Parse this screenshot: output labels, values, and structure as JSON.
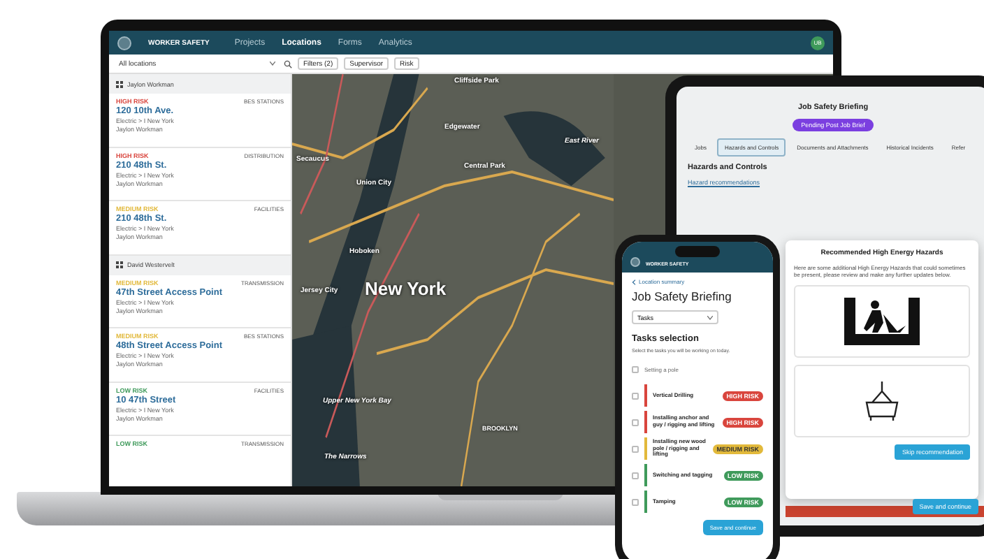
{
  "laptop": {
    "app_name": "WORKER SAFETY",
    "nav": [
      {
        "label": "Projects",
        "selected": false
      },
      {
        "label": "Locations",
        "selected": true
      },
      {
        "label": "Forms",
        "selected": false
      },
      {
        "label": "Analytics",
        "selected": false
      }
    ],
    "avatar": "UB",
    "toolbar": {
      "location_select": "All locations",
      "filters": "Filters (2)",
      "supervisor": "Supervisor",
      "risk": "Risk"
    },
    "groups": [
      {
        "name": "Jaylon Workman",
        "items": [
          {
            "color": "#d9453d",
            "risk_label": "HIGH RISK",
            "category": "BES STATIONS",
            "title": "120 10th Ave.",
            "path": "Electric > I New York",
            "person": "Jaylon Workman"
          },
          {
            "color": "#d9453d",
            "risk_label": "HIGH RISK",
            "category": "DISTRIBUTION",
            "title": "210 48th St.",
            "path": "Electric > I New York",
            "person": "Jaylon Workman"
          },
          {
            "color": "#e2b93b",
            "risk_label": "MEDIUM RISK",
            "category": "FACILITIES",
            "title": "210 48th St.",
            "path": "Electric > I New York",
            "person": "Jaylon Workman"
          }
        ]
      },
      {
        "name": "David Westervelt",
        "items": [
          {
            "color": "#e2b93b",
            "risk_label": "MEDIUM RISK",
            "category": "TRANSMISSION",
            "title": "47th Street Access Point",
            "path": "Electric > I New York",
            "person": "Jaylon Workman"
          },
          {
            "color": "#e2b93b",
            "risk_label": "MEDIUM RISK",
            "category": "BES STATIONS",
            "title": "48th Street Access Point",
            "path": "Electric > I New York",
            "person": "Jaylon Workman"
          },
          {
            "color": "#3f9a5b",
            "risk_label": "LOW RISK",
            "category": "FACILITIES",
            "title": "10 47th Street",
            "path": "Electric > I New York",
            "person": "Jaylon Workman"
          },
          {
            "color": "#3f9a5b",
            "risk_label": "LOW RISK",
            "category": "TRANSMISSION"
          }
        ]
      }
    ],
    "map_labels": [
      {
        "text": "Cliffside Park",
        "kind": "place"
      },
      {
        "text": "Edgewater",
        "kind": "place"
      },
      {
        "text": "Secaucus",
        "kind": "place"
      },
      {
        "text": "Union City",
        "kind": "place"
      },
      {
        "text": "Hoboken",
        "kind": "place"
      },
      {
        "text": "Jersey City",
        "kind": "place"
      },
      {
        "text": "New York",
        "kind": "city"
      },
      {
        "text": "Central Park",
        "kind": "place"
      },
      {
        "text": "East River",
        "kind": "water"
      },
      {
        "text": "Upper New York Bay",
        "kind": "water"
      },
      {
        "text": "The Narrows",
        "kind": "water"
      },
      {
        "text": "BROOKLYN",
        "kind": "district"
      }
    ]
  },
  "tablet": {
    "title": "Job Safety Briefing",
    "status": "Pending Post Job Brief",
    "tabs": [
      {
        "label": "Jobs",
        "selected": false
      },
      {
        "label": "Hazards and Controls",
        "selected": true
      },
      {
        "label": "Documents and Attachments",
        "selected": false
      },
      {
        "label": "Historical Incidents",
        "selected": false
      },
      {
        "label": "Refer",
        "selected": false
      }
    ],
    "section_title": "Hazards and Controls",
    "link": "Hazard recommendations",
    "modal": {
      "title": "Recommended High Energy Hazards",
      "body": "Here are some additional High Energy Hazards that could sometimes be present, please review and make any further updates below.",
      "skip_button": "Skip recommendation"
    },
    "save_button": "Save and continue"
  },
  "phone": {
    "app_name": "WORKER SAFETY",
    "back_link": "Location summary",
    "title": "Job Safety Briefing",
    "select": "Tasks",
    "section_title": "Tasks selection",
    "section_hint": "Select the tasks you will be working on today.",
    "group": "Setting a pole",
    "group_checked": false,
    "tasks": [
      {
        "name": "Vertical Drilling",
        "color": "#d9453d",
        "risk_label": "HIGH RISK",
        "checked": false
      },
      {
        "name": "Installing anchor and guy / rigging and lifting",
        "color": "#d9453d",
        "risk_label": "HIGH RISK",
        "checked": false
      },
      {
        "name": "Installing new wood pole / rigging and lifting",
        "color": "#e2b93b",
        "risk_label": "MEDIUM RISK",
        "checked": false
      },
      {
        "name": "Switching and tagging",
        "color": "#3f9a5b",
        "risk_label": "LOW RISK",
        "checked": false
      },
      {
        "name": "Tamping",
        "color": "#3f9a5b",
        "risk_label": "LOW RISK",
        "checked": false
      }
    ],
    "save_button": "Save and continue"
  }
}
